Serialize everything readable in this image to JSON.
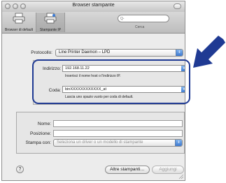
{
  "window": {
    "title": "Browser stampante"
  },
  "toolbar": {
    "default_browser_label": "Browser di default",
    "ip_printer_label": "Stampante IP",
    "search_placeholder": "Q-",
    "search_label": "Cerca"
  },
  "form": {
    "protocol_label": "Protocollo:",
    "protocol_value": "Line Printer Daemon – LPD",
    "address_label": "Indirizzo:",
    "address_value": "192.168.11.22",
    "address_hint": "Inserisci il nome host o l'indirizzo IP.",
    "queue_label": "Coda:",
    "queue_value": "binXXXXXXXXXXXX_at",
    "queue_hint": "Lascia uno spazio vuoto per coda di default."
  },
  "details": {
    "name_label": "Nome:",
    "name_value": "",
    "position_label": "Posizione:",
    "position_value": "",
    "print_with_label": "Stampa con:",
    "print_with_value": "Seleziona un driver o un modello di stampante"
  },
  "footer": {
    "help_label": "?",
    "more_printers_label": "Altre stampanti…",
    "add_label": "Aggiungi"
  },
  "annotation": {
    "arrow_color": "#1f3a93"
  }
}
